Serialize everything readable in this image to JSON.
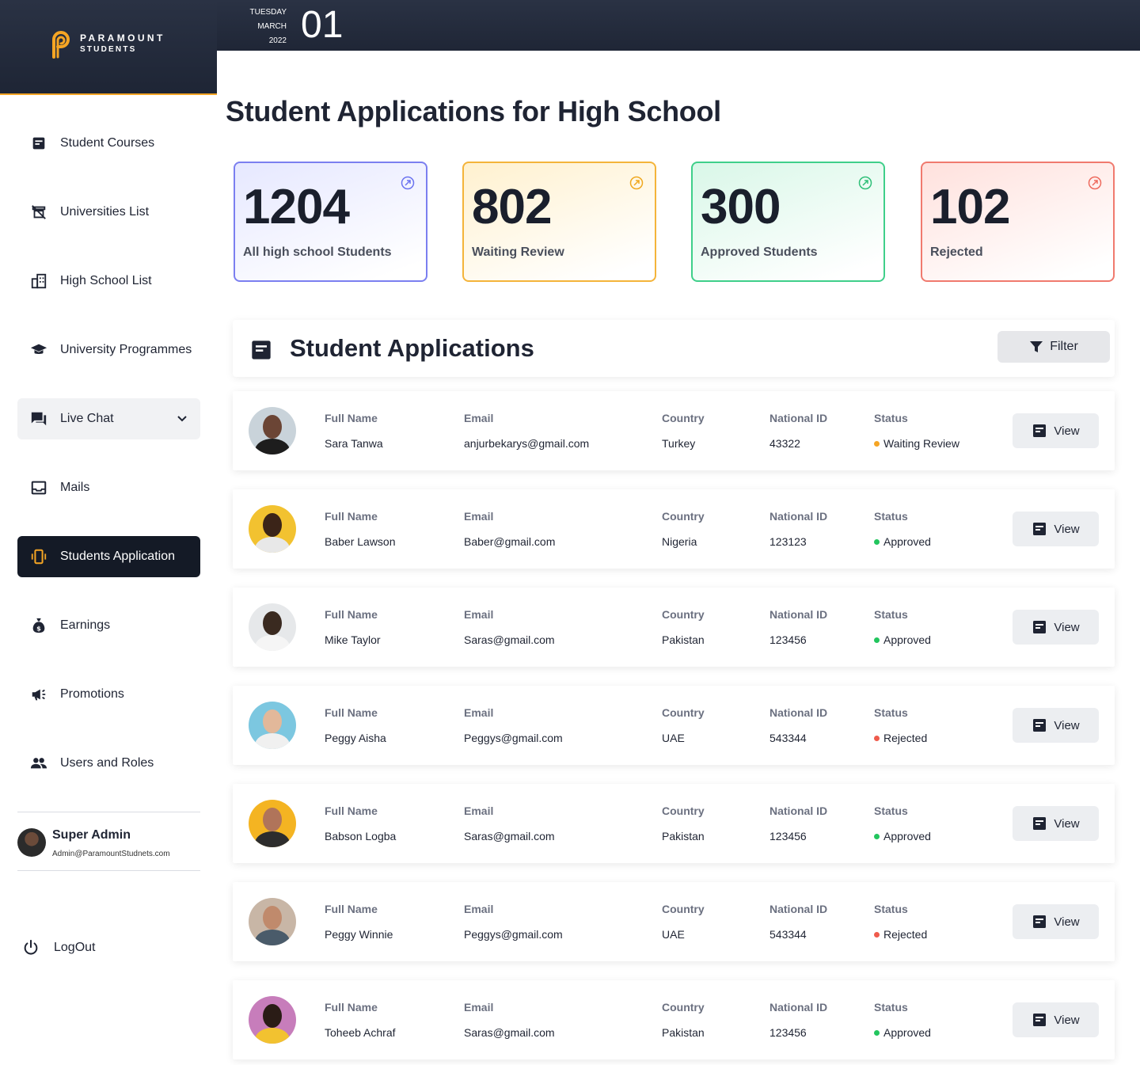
{
  "brand": {
    "name_line1": "PARAMOUNT",
    "name_line2": "STUDENTS"
  },
  "date": {
    "weekday": "TUESDAY",
    "month": "MARCH",
    "year": "2022",
    "day": "01"
  },
  "page_title": "Student Applications for High School",
  "sidebar": {
    "items": [
      {
        "label": "Student Courses",
        "icon": "notes-icon"
      },
      {
        "label": "Universities List",
        "icon": "university-list-icon"
      },
      {
        "label": "High School List",
        "icon": "building-icon"
      },
      {
        "label": "University Programmes",
        "icon": "graduation-cap-icon"
      },
      {
        "label": "Live Chat",
        "icon": "chat-icon"
      },
      {
        "label": "Mails",
        "icon": "inbox-icon"
      },
      {
        "label": "Students Application",
        "icon": "phone-vibrate-icon"
      },
      {
        "label": "Earnings",
        "icon": "money-bag-icon"
      },
      {
        "label": "Promotions",
        "icon": "megaphone-icon"
      },
      {
        "label": "Users and Roles",
        "icon": "users-icon"
      }
    ],
    "active_item": "Students Application",
    "user": {
      "name": "Super Admin",
      "email": "Admin@ParamountStudnets.com"
    },
    "logout_label": "LogOut"
  },
  "stats": [
    {
      "value": "1204",
      "label": "All high school Students",
      "color": "#7b7ff0"
    },
    {
      "value": "802",
      "label": "Waiting Review",
      "color": "#f4b43a"
    },
    {
      "value": "300",
      "label": "Approved Students",
      "color": "#3fcf8a"
    },
    {
      "value": "102",
      "label": "Rejected",
      "color": "#f07a6e"
    }
  ],
  "section": {
    "title": "Student Applications",
    "filter_label": "Filter"
  },
  "columns": {
    "name": "Full Name",
    "email": "Email",
    "country": "Country",
    "national_id": "National ID",
    "status": "Status"
  },
  "view_label": "View",
  "status_colors": {
    "Waiting Review": "#f5a524",
    "Approved": "#22c55e",
    "Rejected": "#ef5b4c"
  },
  "applications": [
    {
      "name": "Sara Tanwa",
      "email": "anjurbekarys@gmail.com",
      "country": "Turkey",
      "national_id": "43322",
      "status": "Waiting Review"
    },
    {
      "name": "Baber Lawson",
      "email": "Baber@gmail.com",
      "country": "Nigeria",
      "national_id": "123123",
      "status": "Approved"
    },
    {
      "name": "Mike Taylor",
      "email": "Saras@gmail.com",
      "country": "Pakistan",
      "national_id": "123456",
      "status": "Approved"
    },
    {
      "name": "Peggy Aisha",
      "email": "Peggys@gmail.com",
      "country": "UAE",
      "national_id": "543344",
      "status": "Rejected"
    },
    {
      "name": "Babson Logba",
      "email": "Saras@gmail.com",
      "country": "Pakistan",
      "national_id": "123456",
      "status": "Approved"
    },
    {
      "name": "Peggy Winnie",
      "email": "Peggys@gmail.com",
      "country": "UAE",
      "national_id": "543344",
      "status": "Rejected"
    },
    {
      "name": "Toheeb Achraf",
      "email": "Saras@gmail.com",
      "country": "Pakistan",
      "national_id": "123456",
      "status": "Approved"
    }
  ]
}
